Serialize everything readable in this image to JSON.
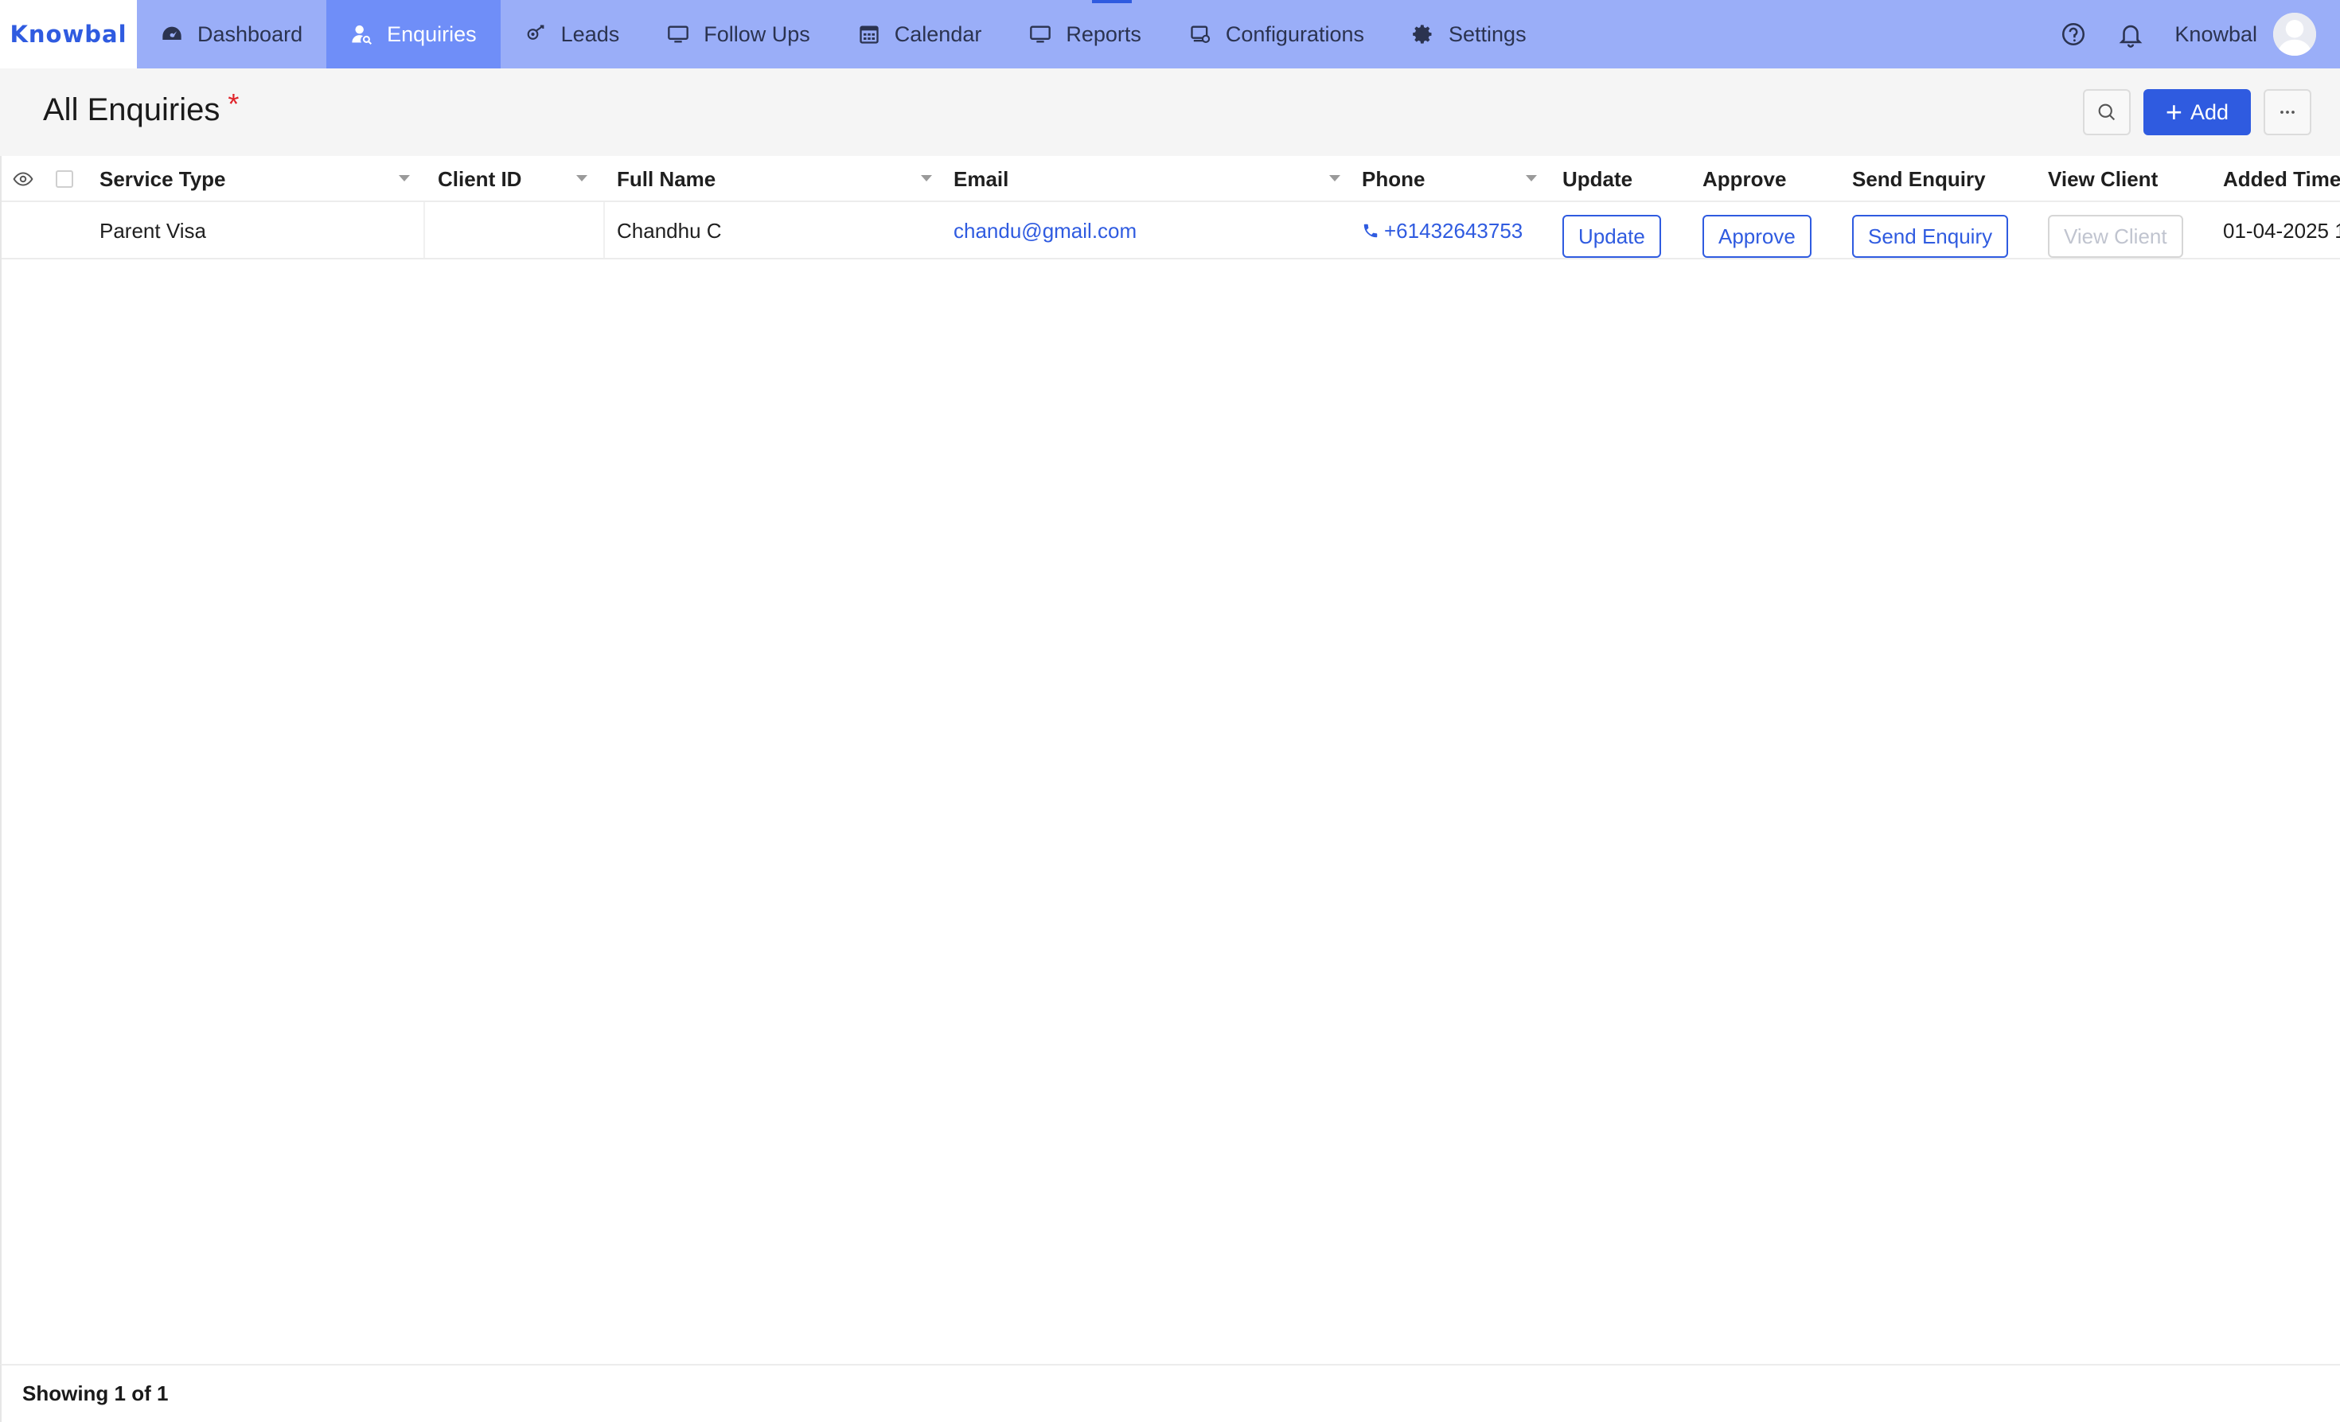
{
  "brand": {
    "name": "Knowbal"
  },
  "nav": {
    "items": [
      {
        "label": "Dashboard",
        "icon": "dashboard-gauge-icon",
        "active": false
      },
      {
        "label": "Enquiries",
        "icon": "user-search-icon",
        "active": true
      },
      {
        "label": "Leads",
        "icon": "leads-icon",
        "active": false
      },
      {
        "label": "Follow Ups",
        "icon": "monitor-icon",
        "active": false
      },
      {
        "label": "Calendar",
        "icon": "calendar-icon",
        "active": false
      },
      {
        "label": "Reports",
        "icon": "monitor-icon",
        "active": false
      },
      {
        "label": "Configurations",
        "icon": "config-icon",
        "active": false
      },
      {
        "label": "Settings",
        "icon": "gear-icon",
        "active": false
      }
    ],
    "user_name": "Knowbal",
    "accent": "#9aaef8",
    "active_bg": "#6f8ef8"
  },
  "page": {
    "title": "All Enquiries",
    "required_marker": "*",
    "add_label": "Add"
  },
  "table": {
    "columns": [
      {
        "key": "service_type",
        "label": "Service Type",
        "sortable": true
      },
      {
        "key": "client_id",
        "label": "Client ID",
        "sortable": true
      },
      {
        "key": "full_name",
        "label": "Full Name",
        "sortable": true
      },
      {
        "key": "email",
        "label": "Email",
        "sortable": true
      },
      {
        "key": "phone",
        "label": "Phone",
        "sortable": true
      },
      {
        "key": "update",
        "label": "Update",
        "sortable": false
      },
      {
        "key": "approve",
        "label": "Approve",
        "sortable": false
      },
      {
        "key": "send_enquiry",
        "label": "Send Enquiry",
        "sortable": false
      },
      {
        "key": "view_client",
        "label": "View Client",
        "sortable": false
      },
      {
        "key": "added_time",
        "label": "Added Time",
        "sortable": false
      }
    ],
    "rows": [
      {
        "service_type": "Parent Visa",
        "client_id": "",
        "full_name": "Chandhu C",
        "email": "chandu@gmail.com",
        "phone": "+61432643753",
        "update_label": "Update",
        "approve_label": "Approve",
        "send_enquiry_label": "Send Enquiry",
        "view_client_label": "View Client",
        "view_client_disabled": true,
        "added_time": "01-04-2025 1"
      }
    ]
  },
  "footer": {
    "showing": "Showing 1 of 1"
  },
  "colors": {
    "primary": "#2f5be0",
    "required": "#e0242a"
  }
}
